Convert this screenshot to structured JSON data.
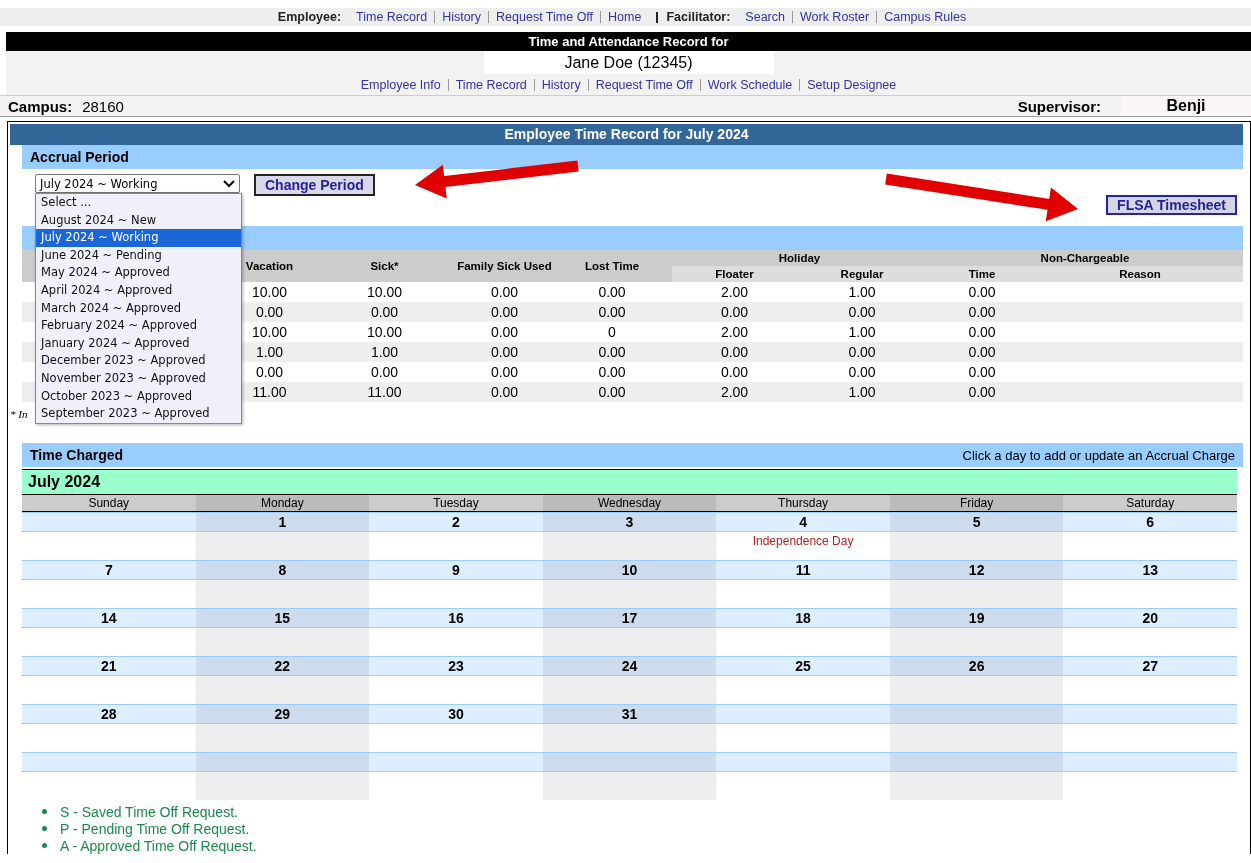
{
  "top_nav": [
    {
      "label": "Employee:",
      "links": [
        "Time Record",
        "History",
        "Request Time Off",
        "Home"
      ]
    },
    {
      "label": "Facilitator:",
      "links": [
        "Search",
        "Work Roster",
        "Campus Rules"
      ]
    }
  ],
  "title_bar": "Time and Attendance Record for",
  "employee_name": "Jane Doe (12345)",
  "sub_nav": [
    "Employee Info",
    "Time Record",
    "History",
    "Request Time Off",
    "Work Schedule",
    "Setup Designee"
  ],
  "campus": {
    "label": "Campus:",
    "value": "28160"
  },
  "supervisor": {
    "label": "Supervisor:",
    "value": "Benji"
  },
  "panel_title": "Employee Time Record for July 2024",
  "accrual_period": {
    "title": "Accrual Period",
    "select_value": "July 2024 ~ Working",
    "button": "Change Period",
    "flsa_button": "FLSA Timesheet",
    "options": [
      {
        "label": "Select ...",
        "selected": false
      },
      {
        "label": "August 2024 ~ New",
        "selected": false
      },
      {
        "label": "July 2024 ~ Working",
        "selected": true
      },
      {
        "label": "June 2024 ~ Pending",
        "selected": false
      },
      {
        "label": "May 2024 ~ Approved",
        "selected": false
      },
      {
        "label": "April 2024 ~ Approved",
        "selected": false
      },
      {
        "label": "March 2024 ~ Approved",
        "selected": false
      },
      {
        "label": "February 2024 ~ Approved",
        "selected": false
      },
      {
        "label": "January 2024 ~ Approved",
        "selected": false
      },
      {
        "label": "December 2023 ~ Approved",
        "selected": false
      },
      {
        "label": "November 2023 ~ Approved",
        "selected": false
      },
      {
        "label": "October 2023 ~ Approved",
        "selected": false
      },
      {
        "label": "September 2023 ~ Approved",
        "selected": false
      }
    ]
  },
  "accruals": {
    "footnote": "* In",
    "columns": [
      "Vacation",
      "Sick*",
      "Family Sick Used",
      "Lost Time"
    ],
    "groups": [
      {
        "label": "Holiday",
        "columns": [
          "Floater",
          "Regular"
        ]
      },
      {
        "label": "Non-Chargeable",
        "columns": [
          "Time",
          "Reason"
        ]
      }
    ],
    "rows": [
      [
        "10.00",
        "10.00",
        "0.00",
        "0.00",
        "2.00",
        "1.00",
        "0.00"
      ],
      [
        "0.00",
        "0.00",
        "0.00",
        "0.00",
        "0.00",
        "0.00",
        "0.00"
      ],
      [
        "10.00",
        "10.00",
        "0.00",
        "0",
        "2.00",
        "1.00",
        "0.00"
      ],
      [
        "1.00",
        "1.00",
        "0.00",
        "0.00",
        "0.00",
        "0.00",
        "0.00"
      ],
      [
        "0.00",
        "0.00",
        "0.00",
        "0.00",
        "0.00",
        "0.00",
        "0.00"
      ],
      [
        "11.00",
        "11.00",
        "0.00",
        "0.00",
        "2.00",
        "1.00",
        "0.00"
      ]
    ]
  },
  "time_charged": {
    "title": "Time Charged",
    "hint": "Click a day to add or update an Accrual Charge",
    "month": "July 2024",
    "weekdays": [
      "Sunday",
      "Monday",
      "Tuesday",
      "Wednesday",
      "Thursday",
      "Friday",
      "Saturday"
    ],
    "weeks": [
      {
        "leading_blank": true,
        "days": [
          {
            "date": "1"
          },
          {
            "date": "2"
          },
          {
            "date": "3"
          },
          {
            "date": "4",
            "holiday": "Independence Day"
          },
          {
            "date": "5"
          },
          {
            "date": "6"
          }
        ]
      },
      {
        "days": [
          {
            "date": "7"
          },
          {
            "date": "8"
          },
          {
            "date": "9"
          },
          {
            "date": "10"
          },
          {
            "date": "11"
          },
          {
            "date": "12"
          },
          {
            "date": "13"
          }
        ]
      },
      {
        "days": [
          {
            "date": "14"
          },
          {
            "date": "15"
          },
          {
            "date": "16"
          },
          {
            "date": "17"
          },
          {
            "date": "18"
          },
          {
            "date": "19"
          },
          {
            "date": "20"
          }
        ]
      },
      {
        "days": [
          {
            "date": "21"
          },
          {
            "date": "22"
          },
          {
            "date": "23"
          },
          {
            "date": "24"
          },
          {
            "date": "25"
          },
          {
            "date": "26"
          },
          {
            "date": "27"
          }
        ]
      },
      {
        "days": [
          {
            "date": "28"
          },
          {
            "date": "29"
          },
          {
            "date": "30"
          },
          {
            "date": "31"
          }
        ]
      }
    ],
    "legend": [
      "S - Saved Time Off Request.",
      "P - Pending Time Off Request.",
      "A - Approved Time Off Request."
    ]
  }
}
